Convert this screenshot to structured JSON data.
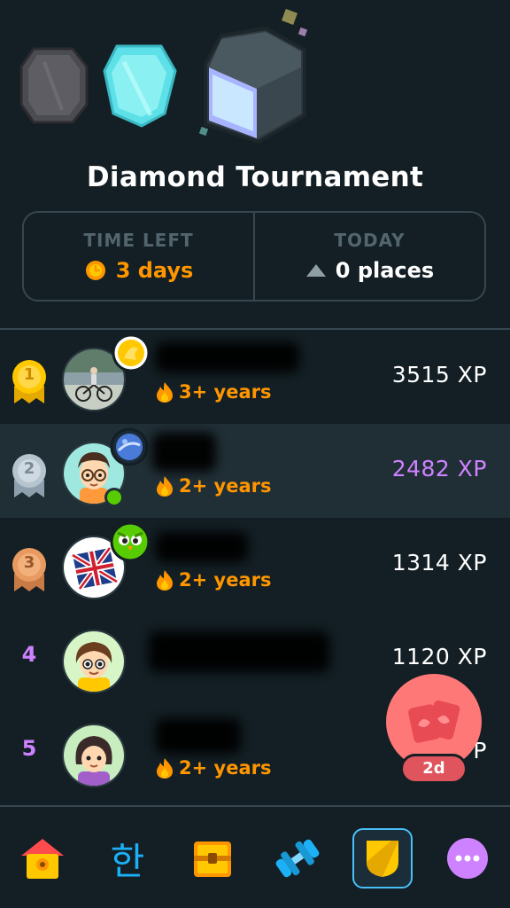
{
  "league": {
    "title": "Diamond Tournament",
    "time_left_label": "TIME LEFT",
    "time_left_value": "3 days",
    "today_label": "TODAY",
    "today_value": "0 places"
  },
  "leaderboard": [
    {
      "rank": "1",
      "streak": "3+ years",
      "xp": "3515 XP",
      "highlight": false
    },
    {
      "rank": "2",
      "streak": "2+ years",
      "xp": "2482 XP",
      "highlight": true
    },
    {
      "rank": "3",
      "streak": "2+ years",
      "xp": "1314 XP",
      "highlight": false
    },
    {
      "rank": "4",
      "streak": "",
      "xp": "1120 XP",
      "highlight": false
    },
    {
      "rank": "5",
      "streak": "2+ years",
      "xp": "P",
      "highlight": false
    }
  ],
  "fab": {
    "label": "2d"
  },
  "nav": {
    "items": [
      "home-icon",
      "korean-character-icon",
      "treasure-chest-icon",
      "dumbbell-icon",
      "league-shield-icon",
      "more-icon"
    ],
    "korean_char": "한"
  },
  "colors": {
    "background": "#131f24",
    "accent_orange": "#ff9600",
    "accent_purple": "#ce82ff",
    "active_border": "#49c0f8"
  }
}
